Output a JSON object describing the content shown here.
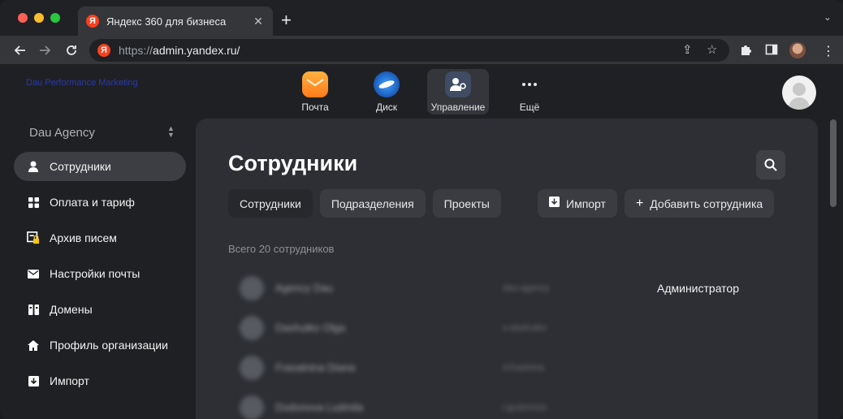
{
  "browser": {
    "tab_title": "Яндекс 360 для бизнеса",
    "tab_favicon": "Я",
    "url_protocol": "https://",
    "url_host": "admin.yandex.ru/"
  },
  "header": {
    "logo_text": "Dau Performance Marketing",
    "apps": [
      {
        "label": "Почта",
        "icon": "mail-icon"
      },
      {
        "label": "Диск",
        "icon": "disk-icon"
      },
      {
        "label": "Управление",
        "icon": "admin-icon"
      },
      {
        "label": "Ещё",
        "icon": "more-icon"
      }
    ]
  },
  "sidebar": {
    "org_name": "Dau Agency",
    "items": [
      {
        "label": "Сотрудники",
        "icon": "person-icon",
        "active": true
      },
      {
        "label": "Оплата и тариф",
        "icon": "grid-icon"
      },
      {
        "label": "Архив писем",
        "icon": "archive-lock-icon"
      },
      {
        "label": "Настройки почты",
        "icon": "envelope-icon"
      },
      {
        "label": "Домены",
        "icon": "domains-icon"
      },
      {
        "label": "Профиль организации",
        "icon": "home-icon"
      },
      {
        "label": "Импорт",
        "icon": "import-icon"
      }
    ]
  },
  "main": {
    "title": "Сотрудники",
    "tabs": [
      "Сотрудники",
      "Подразделения",
      "Проекты"
    ],
    "import_label": "Импорт",
    "add_label": "Добавить сотрудника",
    "total_label": "Всего 20 сотрудников",
    "rows": [
      {
        "name": "Agency Dau",
        "login": "dau-agency",
        "role": "Администратор"
      },
      {
        "name": "Dashutko Olga",
        "login": "o.dashutko",
        "role": ""
      },
      {
        "name": "Frasalnina Diana",
        "login": "d.fraslnina",
        "role": ""
      },
      {
        "name": "Dodonova Ludmila",
        "login": "l.gudonova",
        "role": ""
      }
    ]
  },
  "colors": {
    "accent": "#fc3f1d",
    "background": "#1f2024",
    "panel": "#2d2f34"
  }
}
